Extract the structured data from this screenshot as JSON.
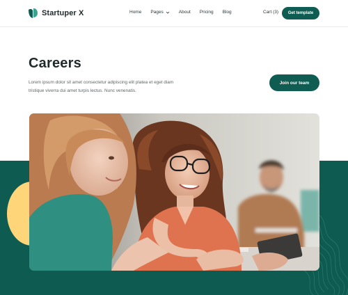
{
  "brand": {
    "name": "Startuper X",
    "icon": "leaf-logo-icon",
    "color": "#0f5c52"
  },
  "nav": {
    "items": [
      {
        "label": "Home"
      },
      {
        "label": "Pages",
        "icon": "chevron-down-icon"
      },
      {
        "label": "About"
      },
      {
        "label": "Pricing"
      },
      {
        "label": "Blog"
      }
    ]
  },
  "header": {
    "cart_label": "Cart (3)",
    "cta_label": "Get template"
  },
  "hero": {
    "title": "Careers",
    "description": "Lorem ipsum dolor sit amet consectetur adipiscing elit platea et eget diam tristique viverra dui amet turpis lectus. Nunc venenatis.",
    "cta_label": "Join our team"
  },
  "colors": {
    "accent": "#0f5c52",
    "band": "#0d5b51",
    "circle": "#ffd57a"
  }
}
